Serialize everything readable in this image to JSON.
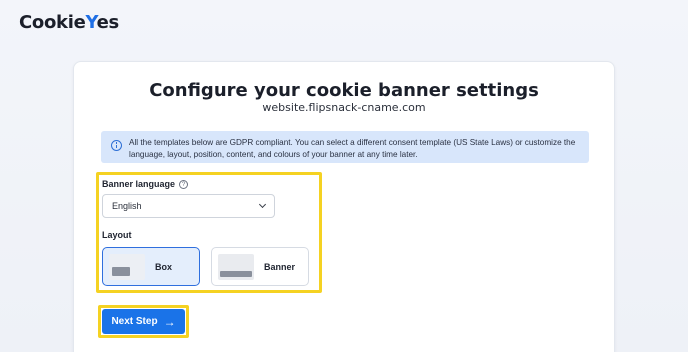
{
  "brand": {
    "logo_text_before": "Cookie",
    "logo_check": "Y",
    "logo_text_after": "es"
  },
  "page": {
    "title": "Configure your cookie banner settings",
    "website": "website.flipsnack-cname.com"
  },
  "info": {
    "icon": "info-icon",
    "text": "All the templates below are GDPR compliant. You can select a different consent template (US State Laws) or customize the language, layout, position, content, and colours of your banner at any time later."
  },
  "language": {
    "label": "Banner language",
    "help_icon": "?",
    "value": "English"
  },
  "layout": {
    "label": "Layout",
    "options": [
      {
        "label": "Box",
        "selected": true
      },
      {
        "label": "Banner",
        "selected": false
      }
    ]
  },
  "actions": {
    "next_label": "Next Step",
    "next_arrow": "→"
  },
  "colors": {
    "accent": "#1a73e8",
    "highlight": "#f5d222",
    "info_bg": "#d8e6fb"
  }
}
